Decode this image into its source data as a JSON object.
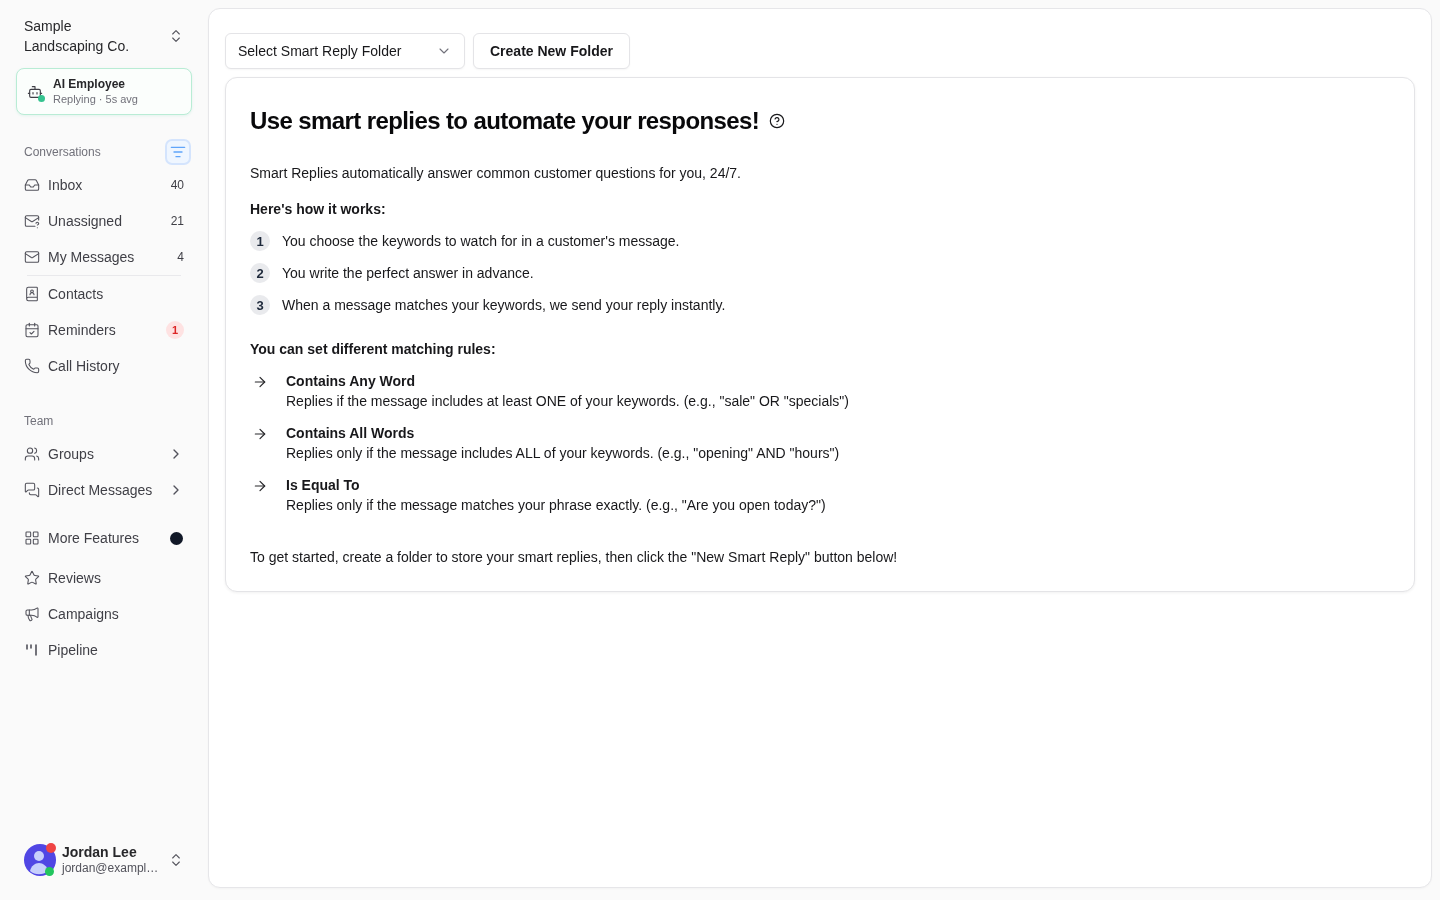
{
  "sidebar": {
    "workspace": {
      "name": "Sample Landscaping Co."
    },
    "ai_employee": {
      "title": "AI Employee",
      "status": "Replying · 5s avg",
      "active": true
    },
    "sections": [
      {
        "title": "Conversations",
        "filter": {
          "active": true
        },
        "groups": [
          {
            "items": [
              {
                "kind": "count",
                "label": "Inbox",
                "count": "40",
                "selected": false
              },
              {
                "kind": "count",
                "label": "Unassigned",
                "count": "21",
                "selected": false
              },
              {
                "kind": "count",
                "label": "My Messages",
                "count": "4",
                "selected": false
              }
            ]
          },
          {
            "items": [
              {
                "kind": "plain",
                "label": "Contacts",
                "selected": false
              },
              {
                "kind": "alert",
                "label": "Reminders",
                "count": "1",
                "selected": false
              },
              {
                "kind": "plain",
                "label": "Call History",
                "selected": false
              }
            ]
          }
        ]
      },
      {
        "title": "Team",
        "groups": [
          {
            "items": [
              {
                "kind": "submenu",
                "label": "Groups",
                "selected": false
              },
              {
                "kind": "submenu",
                "label": "Direct Messages",
                "selected": false
              }
            ]
          }
        ]
      },
      {
        "groups": [
          {
            "items": [
              {
                "kind": "dot",
                "label": "More Features",
                "selected": false
              },
              {
                "kind": "plain",
                "label": "Reviews",
                "selected": false
              },
              {
                "kind": "plain",
                "label": "Campaigns",
                "selected": false
              },
              {
                "kind": "plain",
                "label": "Pipeline",
                "selected": false
              }
            ]
          }
        ]
      }
    ],
    "user": {
      "name": "Jordan Lee",
      "email": "jordan@exampl…",
      "online": true,
      "has_notification": true
    }
  },
  "main": {
    "toolbar": {
      "folder_select": {
        "placeholder": "Select Smart Reply Folder"
      },
      "create_button": "Create New Folder"
    },
    "intro_card": {
      "title": "Use smart replies to automate your responses!",
      "intro": "Smart Replies automatically answer common customer questions for you, 24/7.",
      "steps_heading": "Here's how it works:",
      "steps": [
        {
          "number": "1",
          "text": "You choose the keywords to watch for in a customer's message."
        },
        {
          "number": "2",
          "text": "You write the perfect answer in advance."
        },
        {
          "number": "3",
          "text": "When a message matches your keywords, we send your reply instantly."
        }
      ],
      "rules_heading": "You can set different matching rules:",
      "rules": [
        {
          "name": "Contains Any Word",
          "description": "Replies if the message includes at least ONE of your keywords. (e.g., \"sale\" OR \"specials\")"
        },
        {
          "name": "Contains All Words",
          "description": "Replies only if the message includes ALL of your keywords. (e.g., \"opening\" AND \"hours\")"
        },
        {
          "name": "Is Equal To",
          "description": "Replies only if the message matches your phrase exactly. (e.g., \"Are you open today?\")"
        }
      ],
      "footer": "To get started, create a folder to store your smart replies, then click the \"New Smart Reply\" button below!"
    }
  }
}
